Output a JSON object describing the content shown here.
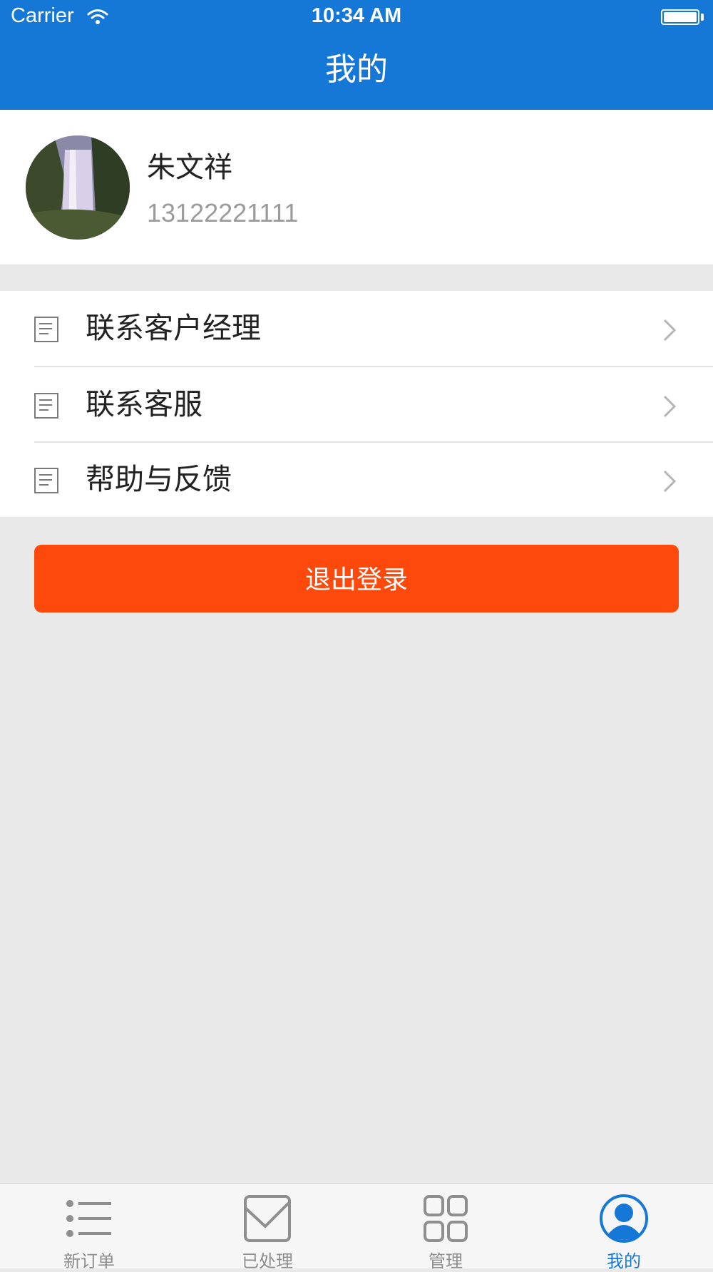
{
  "status_bar": {
    "carrier": "Carrier",
    "time": "10:34 AM"
  },
  "header": {
    "title": "我的"
  },
  "profile": {
    "name": "朱文祥",
    "phone": "13122221111"
  },
  "menu": {
    "items": [
      {
        "label": "联系客户经理",
        "icon": "document-icon"
      },
      {
        "label": "联系客服",
        "icon": "document-icon"
      },
      {
        "label": "帮助与反馈",
        "icon": "document-icon"
      }
    ]
  },
  "logout": {
    "label": "退出登录"
  },
  "tabbar": {
    "tabs": [
      {
        "label": "新订单",
        "icon": "list-icon"
      },
      {
        "label": "已处理",
        "icon": "check-box-icon"
      },
      {
        "label": "管理",
        "icon": "grid-icon"
      },
      {
        "label": "我的",
        "icon": "user-icon"
      }
    ],
    "active": "我的"
  },
  "colors": {
    "primary": "#1577d6",
    "logout": "#fd4a0c",
    "background": "#e9e9e9"
  }
}
